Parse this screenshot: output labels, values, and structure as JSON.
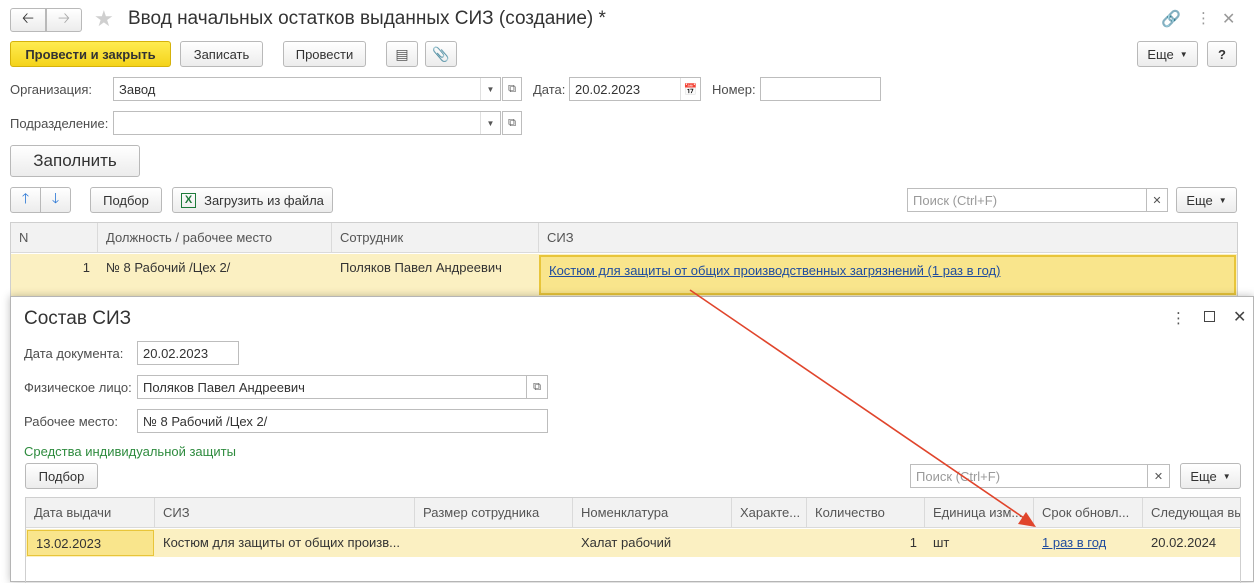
{
  "window": {
    "title": "Ввод начальных остатков выданных СИЗ (создание) *"
  },
  "toolbar": {
    "post_close": "Провести и закрыть",
    "save": "Записать",
    "post": "Провести",
    "more": "Еще",
    "help": "?"
  },
  "form": {
    "org_label": "Организация:",
    "org_value": "Завод",
    "date_label": "Дата:",
    "date_value": "20.02.2023",
    "number_label": "Номер:",
    "number_value": "",
    "dept_label": "Подразделение:",
    "dept_value": "",
    "fill_button": "Заполнить"
  },
  "table_toolbar": {
    "select": "Подбор",
    "load_file": "Загрузить из файла",
    "search_placeholder": "Поиск (Ctrl+F)",
    "more": "Еще"
  },
  "main_table": {
    "headers": [
      "N",
      "Должность / рабочее место",
      "Сотрудник",
      "СИЗ"
    ],
    "rows": [
      {
        "n": "1",
        "position": "№ 8 Рабочий /Цех 2/",
        "employee": "Поляков Павел Андреевич",
        "siz": "Костюм для защиты от общих производственных загрязнений (1 раз в год)"
      }
    ]
  },
  "dialog": {
    "title": "Состав СИЗ",
    "doc_date_label": "Дата документа:",
    "doc_date_value": "20.02.2023",
    "person_label": "Физическое лицо:",
    "person_value": "Поляков Павел Андреевич",
    "workplace_label": "Рабочее место:",
    "workplace_value": "№ 8 Рабочий /Цех 2/",
    "section_title": "Средства индивидуальной защиты",
    "select": "Подбор",
    "search_placeholder": "Поиск (Ctrl+F)",
    "more": "Еще",
    "table": {
      "headers": [
        "Дата выдачи",
        "СИЗ",
        "Размер сотрудника",
        "Номенклатура",
        "Характе...",
        "Количество",
        "Единица изм...",
        "Срок обновл...",
        "Следующая вы"
      ],
      "rows": [
        {
          "date": "13.02.2023",
          "siz": "Костюм для защиты от общих произв...",
          "size": "",
          "nomenclature": "Халат рабочий",
          "char": "",
          "qty": "1",
          "unit": "шт",
          "period": "1 раз в год",
          "next": "20.02.2024"
        }
      ]
    }
  },
  "colors": {
    "accent_yellow": "#f6d71f",
    "row_highlight": "#fbf0c2",
    "selected_cell": "#f9e58c",
    "link": "#1f4c9e",
    "section_green": "#2e8b3e",
    "arrow_red": "#e0452c"
  }
}
